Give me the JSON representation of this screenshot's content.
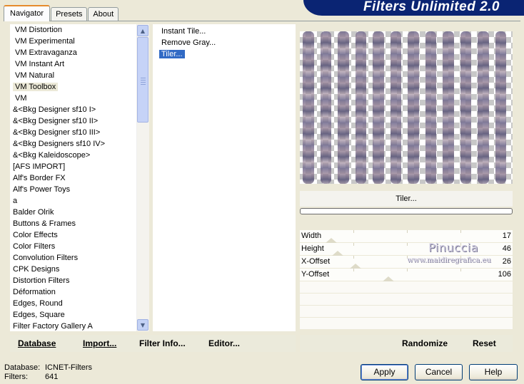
{
  "tabs": [
    {
      "label": "Navigator",
      "active": true
    },
    {
      "label": "Presets",
      "active": false
    },
    {
      "label": "About",
      "active": false
    }
  ],
  "banner_title": "Filters Unlimited 2.0",
  "categories": [
    {
      "label": "VM Distortion",
      "selected": false,
      "indent": true
    },
    {
      "label": "VM Experimental",
      "selected": false,
      "indent": true
    },
    {
      "label": "VM Extravaganza",
      "selected": false,
      "indent": true
    },
    {
      "label": "VM Instant Art",
      "selected": false,
      "indent": true
    },
    {
      "label": "VM Natural",
      "selected": false,
      "indent": true
    },
    {
      "label": "VM Toolbox",
      "selected": true,
      "indent": true
    },
    {
      "label": "VM",
      "selected": false,
      "indent": true
    },
    {
      "label": "&<Bkg Designer sf10 I>",
      "selected": false,
      "indent": false
    },
    {
      "label": "&<Bkg Designer sf10 II>",
      "selected": false,
      "indent": false
    },
    {
      "label": "&<Bkg Designer sf10 III>",
      "selected": false,
      "indent": false
    },
    {
      "label": "&<Bkg Designers sf10 IV>",
      "selected": false,
      "indent": false
    },
    {
      "label": "&<Bkg Kaleidoscope>",
      "selected": false,
      "indent": false
    },
    {
      "label": "[AFS IMPORT]",
      "selected": false,
      "indent": false
    },
    {
      "label": "Alf's Border FX",
      "selected": false,
      "indent": false
    },
    {
      "label": "Alf's Power Toys",
      "selected": false,
      "indent": false
    },
    {
      "label": "a",
      "selected": false,
      "indent": false
    },
    {
      "label": "Balder Olrik",
      "selected": false,
      "indent": false
    },
    {
      "label": "Buttons & Frames",
      "selected": false,
      "indent": false
    },
    {
      "label": "Color Effects",
      "selected": false,
      "indent": false
    },
    {
      "label": "Color Filters",
      "selected": false,
      "indent": false
    },
    {
      "label": "Convolution Filters",
      "selected": false,
      "indent": false
    },
    {
      "label": "CPK Designs",
      "selected": false,
      "indent": false
    },
    {
      "label": "Distortion Filters",
      "selected": false,
      "indent": false
    },
    {
      "label": "Déformation",
      "selected": false,
      "indent": false
    },
    {
      "label": "Edges, Round",
      "selected": false,
      "indent": false
    },
    {
      "label": "Edges, Square",
      "selected": false,
      "indent": false
    },
    {
      "label": "Filter Factory Gallery A",
      "selected": false,
      "indent": false
    }
  ],
  "filters": [
    {
      "label": "Instant Tile...",
      "selected": false
    },
    {
      "label": "Remove Gray...",
      "selected": false
    },
    {
      "label": "Tiler...",
      "selected": true
    }
  ],
  "preview_label": "Tiler...",
  "parameters": [
    {
      "label": "Width",
      "value": "17"
    },
    {
      "label": "Height",
      "value": "46"
    },
    {
      "label": "X-Offset",
      "value": "26"
    },
    {
      "label": "Y-Offset",
      "value": "106"
    }
  ],
  "watermark": {
    "name": "Pinuccia",
    "url": "www.maidiregrafica.eu"
  },
  "left_buttons": {
    "database": "Database",
    "import": "Import...",
    "filter_info": "Filter Info...",
    "editor": "Editor..."
  },
  "right_buttons": {
    "randomize": "Randomize",
    "reset": "Reset"
  },
  "status": {
    "database_label": "Database:",
    "database_value": "ICNET-Filters",
    "filters_label": "Filters:",
    "filters_value": "641"
  },
  "dialog_buttons": {
    "apply": "Apply",
    "cancel": "Cancel",
    "help": "Help"
  },
  "colors": {
    "selection": "#316ac5",
    "banner": "#0a2473",
    "background": "#ece9d8"
  }
}
